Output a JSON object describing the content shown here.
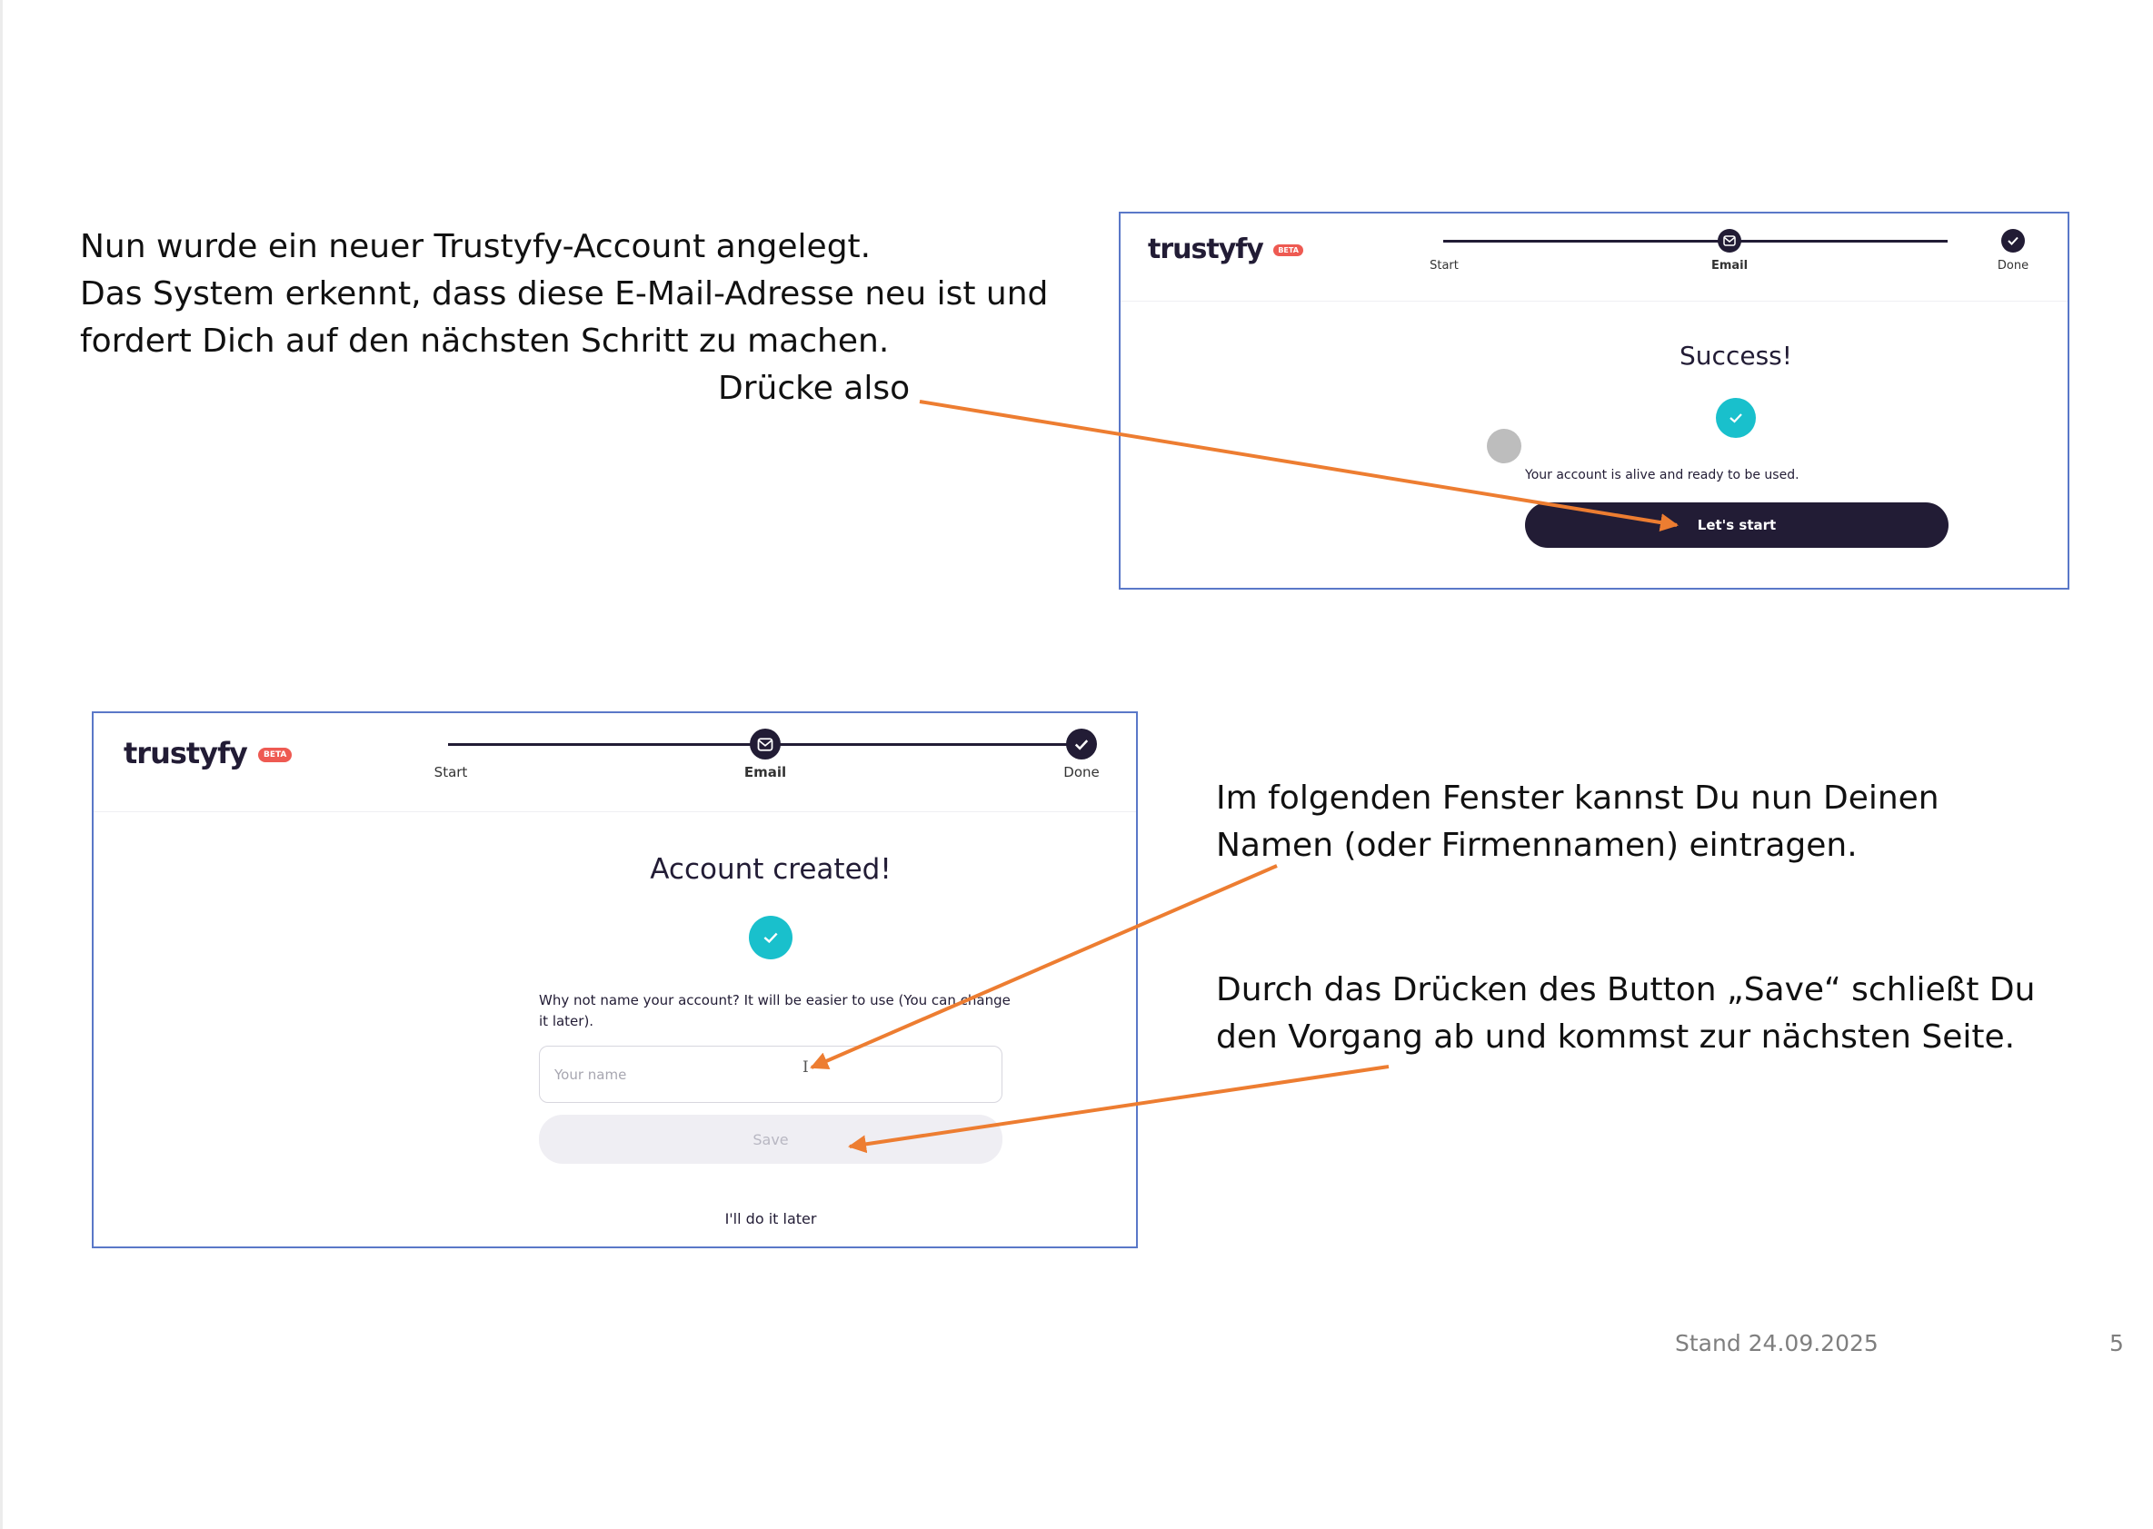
{
  "intro": {
    "lines": [
      "Nun wurde ein neuer Trustyfy-Account angelegt.",
      "Das System erkennt, dass diese E-Mail-Adresse neu ist und",
      "fordert Dich auf den nächsten Schritt zu machen."
    ],
    "press_hint": "Drücke also"
  },
  "screenshot_success": {
    "logo": "trustyfy",
    "beta": "BETA",
    "steps": [
      "Start",
      "Email",
      "Done"
    ],
    "heading": "Success!",
    "message": "Your account is alive and ready to be used.",
    "button": "Let's start"
  },
  "screenshot_account": {
    "logo": "trustyfy",
    "beta": "BETA",
    "steps": [
      "Start",
      "Email",
      "Done"
    ],
    "heading": "Account created!",
    "prompt": "Why not name your account? It will be easier to use (You can change it later).",
    "input_placeholder": "Your name",
    "save_button": "Save",
    "later_link": "I'll do it later"
  },
  "explain": {
    "name_lines": [
      "Im folgenden Fenster kannst Du nun Deinen",
      "Namen (oder Firmennamen) eintragen."
    ],
    "save_lines": [
      "Durch das Drücken des Button „Save“ schließt Du",
      "den Vorgang ab und kommst zur nächsten Seite."
    ]
  },
  "footer": {
    "date": "Stand 24.09.2025",
    "page": "5"
  },
  "colors": {
    "arrow": "#ed7d31",
    "brand_dark": "#221c35",
    "accent_teal": "#19c0cc",
    "beta_badge": "#ee5a52",
    "frame": "#5a78c8"
  }
}
